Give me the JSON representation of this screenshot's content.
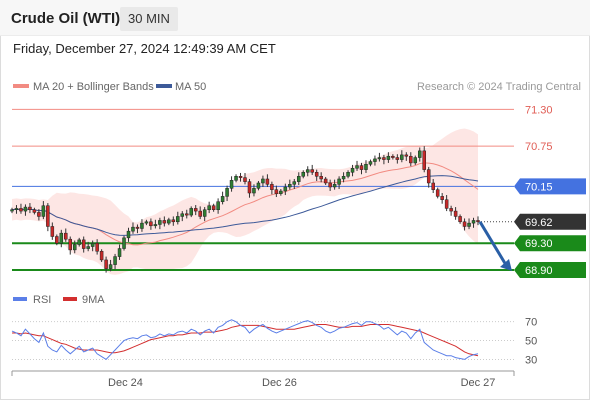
{
  "header": {
    "title": "Crude Oil (WTI)",
    "timeframe": "30 MIN"
  },
  "datetime": "Friday, December 27, 2024 12:49:39 AM CET",
  "copyright": "Research © 2024 Trading Central",
  "colors": {
    "bollinger": "#f28b82",
    "ma50": "#3d5a99",
    "resistance": "#f28b82",
    "pivot": "#4472e0",
    "support": "#1a8a1a",
    "arrow": "#2a5fa6",
    "candle_up": "#2e7d32",
    "candle_down": "#c62828",
    "rsi": "#5b7fe8",
    "rsi_ma": "#d32f2f"
  },
  "chart_data": [
    {
      "type": "candlestick",
      "title": "Crude Oil (WTI)",
      "interval": "30 MIN",
      "legend": [
        {
          "name": "MA 20 + Bollinger Bands",
          "color": "#f28b82"
        },
        {
          "name": "MA 50",
          "color": "#3d5a99"
        }
      ],
      "ylim": [
        68.75,
        71.5
      ],
      "x_ticks": [
        {
          "label": "Dec 24",
          "index": 28
        },
        {
          "label": "Dec 26",
          "index": 66
        },
        {
          "label": "Dec 27",
          "index": 115
        }
      ],
      "levels": [
        {
          "label": "71.30",
          "value": 71.3,
          "kind": "resistance"
        },
        {
          "label": "70.75",
          "value": 70.75,
          "kind": "resistance"
        },
        {
          "label": "70.15",
          "value": 70.15,
          "kind": "pivot"
        },
        {
          "label": "69.62",
          "value": 69.62,
          "kind": "last"
        },
        {
          "label": "69.30",
          "value": 69.3,
          "kind": "support"
        },
        {
          "label": "68.90",
          "value": 68.9,
          "kind": "support"
        }
      ],
      "close": [
        69.8,
        69.82,
        69.78,
        69.84,
        69.8,
        69.76,
        69.7,
        69.86,
        69.55,
        69.4,
        69.3,
        69.45,
        69.36,
        69.2,
        69.28,
        69.35,
        69.22,
        69.25,
        69.3,
        69.18,
        69.05,
        68.92,
        68.98,
        69.1,
        69.22,
        69.38,
        69.48,
        69.54,
        69.52,
        69.6,
        69.62,
        69.56,
        69.58,
        69.64,
        69.6,
        69.65,
        69.62,
        69.7,
        69.74,
        69.72,
        69.82,
        69.78,
        69.7,
        69.8,
        69.86,
        69.8,
        69.92,
        70.0,
        70.12,
        70.24,
        70.3,
        70.28,
        70.22,
        70.05,
        70.12,
        70.2,
        70.26,
        70.18,
        70.1,
        70.04,
        70.08,
        70.14,
        70.18,
        70.22,
        70.3,
        70.36,
        70.4,
        70.36,
        70.3,
        70.26,
        70.2,
        70.14,
        70.18,
        70.26,
        70.3,
        70.36,
        70.42,
        70.46,
        70.4,
        70.48,
        70.52,
        70.56,
        70.58,
        70.55,
        70.6,
        70.58,
        70.55,
        70.62,
        70.6,
        70.5,
        70.58,
        70.68,
        70.4,
        70.2,
        70.1,
        70.0,
        69.95,
        69.82,
        69.78,
        69.7,
        69.62,
        69.55,
        69.6,
        69.64,
        69.62
      ],
      "ma20_lower_band_approx": true
    },
    {
      "type": "line",
      "title": "RSI",
      "legend": [
        {
          "name": "RSI",
          "color": "#5b7fe8"
        },
        {
          "name": "9MA",
          "color": "#d32f2f"
        }
      ],
      "ylim": [
        22,
        76
      ],
      "y_ticks": [
        70,
        50,
        30
      ],
      "rsi": [
        60,
        58,
        55,
        62,
        57,
        52,
        48,
        58,
        44,
        40,
        38,
        45,
        40,
        36,
        40,
        44,
        38,
        40,
        42,
        36,
        33,
        30,
        35,
        40,
        45,
        50,
        52,
        53,
        52,
        55,
        56,
        53,
        54,
        57,
        55,
        57,
        56,
        59,
        60,
        58,
        62,
        60,
        56,
        60,
        62,
        58,
        64,
        66,
        70,
        72,
        70,
        66,
        64,
        58,
        62,
        65,
        67,
        63,
        60,
        58,
        60,
        62,
        64,
        66,
        68,
        70,
        71,
        69,
        66,
        64,
        60,
        58,
        60,
        63,
        64,
        66,
        68,
        69,
        66,
        70,
        70,
        68,
        66,
        62,
        64,
        60,
        56,
        60,
        58,
        52,
        58,
        62,
        48,
        44,
        40,
        38,
        36,
        34,
        34,
        32,
        31,
        30,
        33,
        35,
        36
      ],
      "rsi_ma9": [
        58,
        58,
        57,
        58,
        57,
        56,
        55,
        55,
        53,
        51,
        49,
        47,
        46,
        44,
        42,
        41,
        40,
        40,
        40,
        40,
        39,
        38,
        37,
        37,
        38,
        39,
        41,
        43,
        45,
        47,
        49,
        51,
        52,
        53,
        54,
        55,
        55,
        56,
        56,
        57,
        58,
        58,
        58,
        59,
        59,
        59,
        60,
        61,
        62,
        64,
        65,
        66,
        66,
        66,
        66,
        66,
        65,
        64,
        63,
        62,
        62,
        62,
        62,
        62,
        63,
        64,
        65,
        66,
        67,
        67,
        67,
        66,
        65,
        64,
        64,
        64,
        65,
        65,
        65,
        66,
        67,
        67,
        67,
        67,
        67,
        66,
        65,
        64,
        63,
        62,
        61,
        60,
        58,
        56,
        54,
        52,
        50,
        48,
        46,
        44,
        41,
        38,
        36,
        35,
        34
      ]
    }
  ]
}
